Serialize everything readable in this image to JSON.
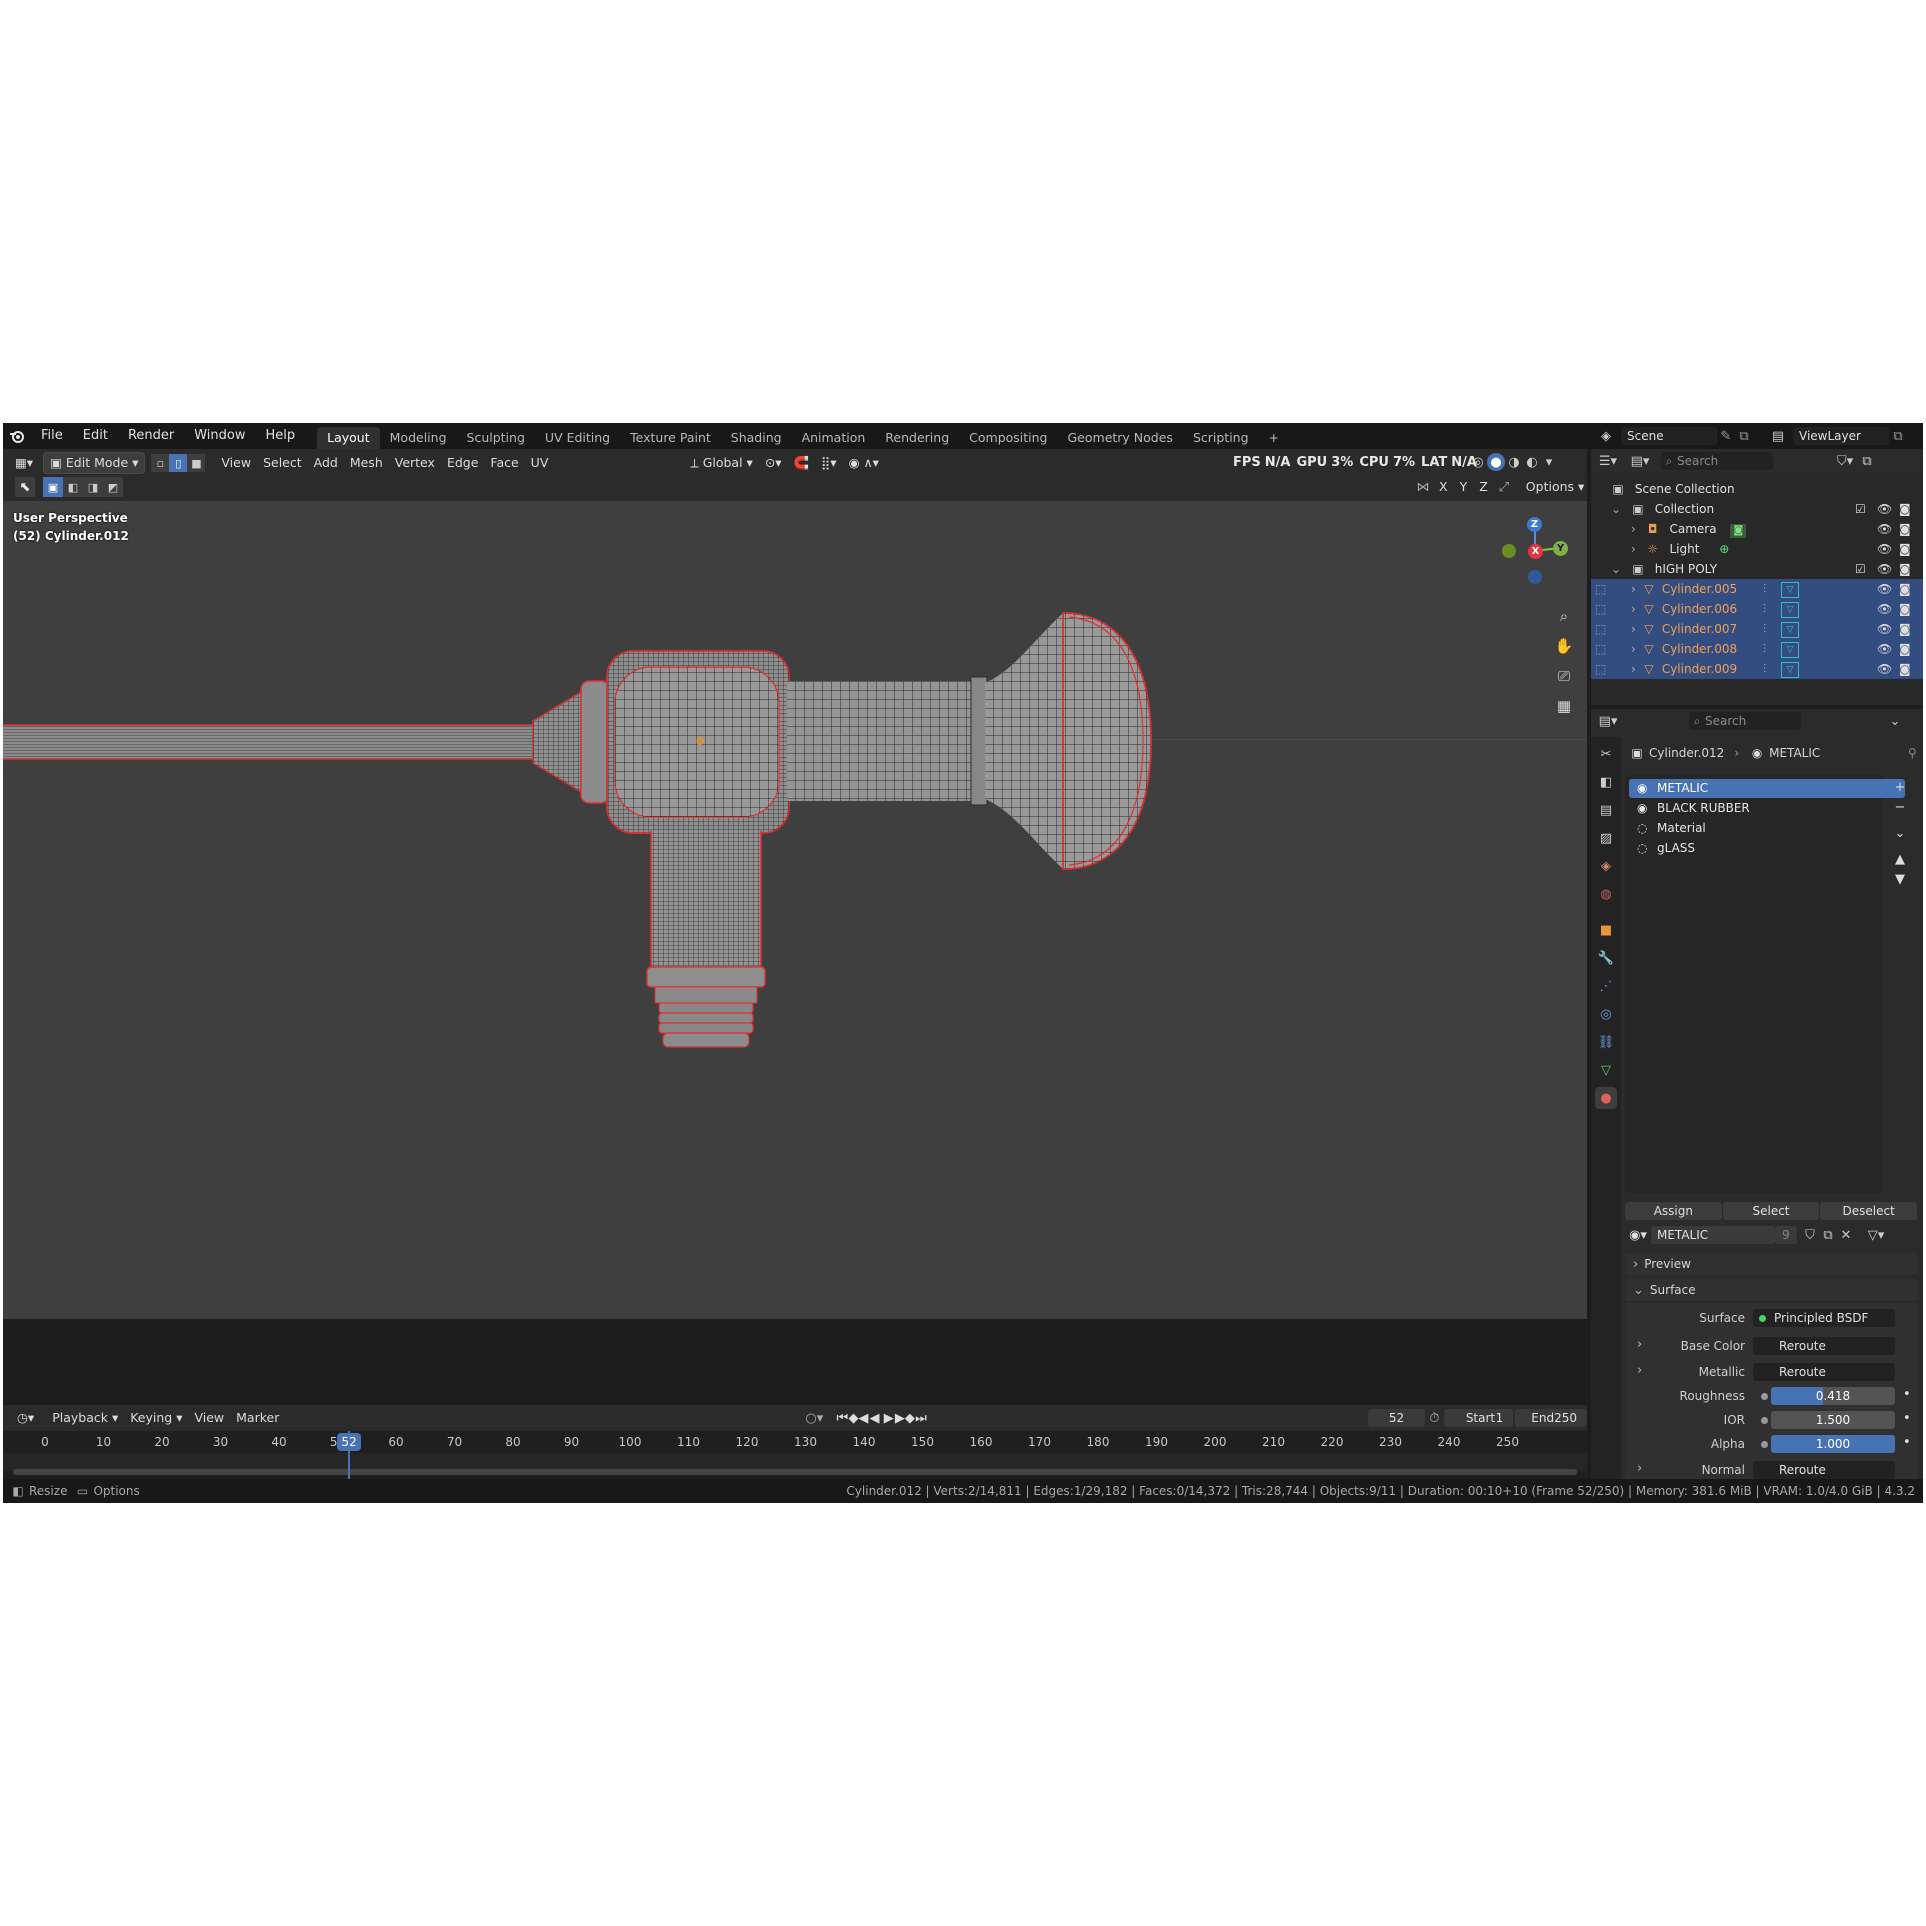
{
  "menu": [
    "File",
    "Edit",
    "Render",
    "Window",
    "Help"
  ],
  "workspaces": [
    "Layout",
    "Modeling",
    "Sculpting",
    "UV Editing",
    "Texture Paint",
    "Shading",
    "Animation",
    "Rendering",
    "Compositing",
    "Geometry Nodes",
    "Scripting"
  ],
  "workspace_add": "+",
  "scene": {
    "label": "Scene",
    "viewlayer": "ViewLayer"
  },
  "viewport_header": {
    "mode": "Edit Mode",
    "menus": [
      "View",
      "Select",
      "Add",
      "Mesh",
      "Vertex",
      "Edge",
      "Face",
      "UV"
    ],
    "transform": "Global",
    "options": "Options",
    "axes": [
      "X",
      "Y",
      "Z"
    ],
    "stats": {
      "fps": "FPS",
      "fps_val": "N/A",
      "gpu": "GPU",
      "gpu_val": "3%",
      "cpu": "CPU",
      "cpu_val": "7%",
      "lat": "LAT",
      "lat_val": "N/A"
    }
  },
  "viewport": {
    "view_name": "User Perspective",
    "object_info": "(52) Cylinder.012"
  },
  "gizmo": {
    "x": "X",
    "y": "Y",
    "z": "Z"
  },
  "outliner": {
    "search_placeholder": "Search",
    "scene_collection": "Scene Collection",
    "collection": "Collection",
    "camera": "Camera",
    "light": "Light",
    "high_poly": "hIGH POLY",
    "objects": [
      "Cylinder.005",
      "Cylinder.006",
      "Cylinder.007",
      "Cylinder.008",
      "Cylinder.009"
    ]
  },
  "properties": {
    "search_placeholder": "Search",
    "breadcrumb_object": "Cylinder.012",
    "breadcrumb_material": "METALIC",
    "slots": [
      "METALIC",
      "BLACK RUBBER",
      "Material",
      "gLASS"
    ],
    "assign": "Assign",
    "select": "Select",
    "deselect": "Deselect",
    "material_name": "METALIC",
    "user_count": "9",
    "preview": "Preview",
    "surface_panel": "Surface",
    "surface_label": "Surface",
    "surface_value": "Principled BSDF",
    "inputs": [
      {
        "label": "Base Color",
        "value": "Reroute"
      },
      {
        "label": "Metallic",
        "value": "Reroute"
      },
      {
        "label": "Roughness",
        "value": "0.418",
        "fill": 0.418
      },
      {
        "label": "IOR",
        "value": "1.500"
      },
      {
        "label": "Alpha",
        "value": "1.000",
        "fill": 1.0
      },
      {
        "label": "Normal",
        "value": "Reroute"
      }
    ]
  },
  "timeline": {
    "menus": [
      "Playback",
      "Keying",
      "View",
      "Marker"
    ],
    "current_frame": "52",
    "start_label": "Start",
    "start": "1",
    "end_label": "End",
    "end": "250",
    "ticks": [
      "0",
      "10",
      "20",
      "30",
      "40",
      "50",
      "60",
      "70",
      "80",
      "90",
      "100",
      "110",
      "120",
      "130",
      "140",
      "150",
      "160",
      "170",
      "180",
      "190",
      "200",
      "210",
      "220",
      "230",
      "240",
      "250"
    ]
  },
  "statusbar": {
    "left_items": [
      "Resize",
      "Options"
    ],
    "info": "Cylinder.012 | Verts:2/14,811 | Edges:1/29,182 | Faces:0/14,372 | Tris:28,744 | Objects:9/11 | Duration: 00:10+10 (Frame 52/250) | Memory: 381.6 MiB | VRAM: 1.0/4.0 GiB | 4.3.2"
  },
  "colors": {
    "accent": "#4772b3",
    "selection_orange": "#f0a050",
    "viewport_bg": "#3f3f3f",
    "edge_highlight": "#e03030"
  }
}
